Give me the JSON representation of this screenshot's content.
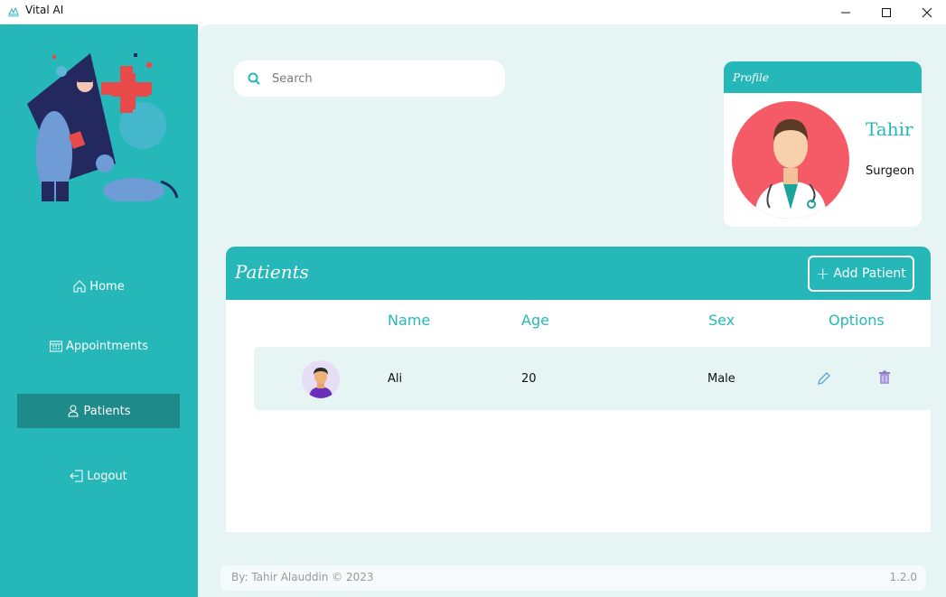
{
  "window": {
    "title": "Vital AI"
  },
  "search": {
    "placeholder": "Search"
  },
  "sidebar": {
    "items": [
      {
        "label": "Home",
        "icon": "home-icon"
      },
      {
        "label": "Appointments",
        "icon": "calendar-icon"
      },
      {
        "label": "Patients",
        "icon": "patient-icon",
        "active": true
      },
      {
        "label": "Logout",
        "icon": "logout-icon"
      }
    ]
  },
  "profile": {
    "heading": "Profile",
    "name": "Tahir",
    "role": "Surgeon"
  },
  "patients": {
    "title": "Patients",
    "add_label": "Add Patient",
    "columns": [
      "Name",
      "Age",
      "Sex",
      "Options"
    ],
    "rows": [
      {
        "name": "Ali",
        "age": "20",
        "sex": "Male"
      }
    ]
  },
  "footer": {
    "credit": "By: Tahir Alauddin © 2023",
    "version": "1.2.0"
  },
  "colors": {
    "accent": "#26b8b8",
    "accent_dark": "#1e8a8a",
    "background": "#e7f4f4",
    "avatar_bg": "#f45b66"
  }
}
